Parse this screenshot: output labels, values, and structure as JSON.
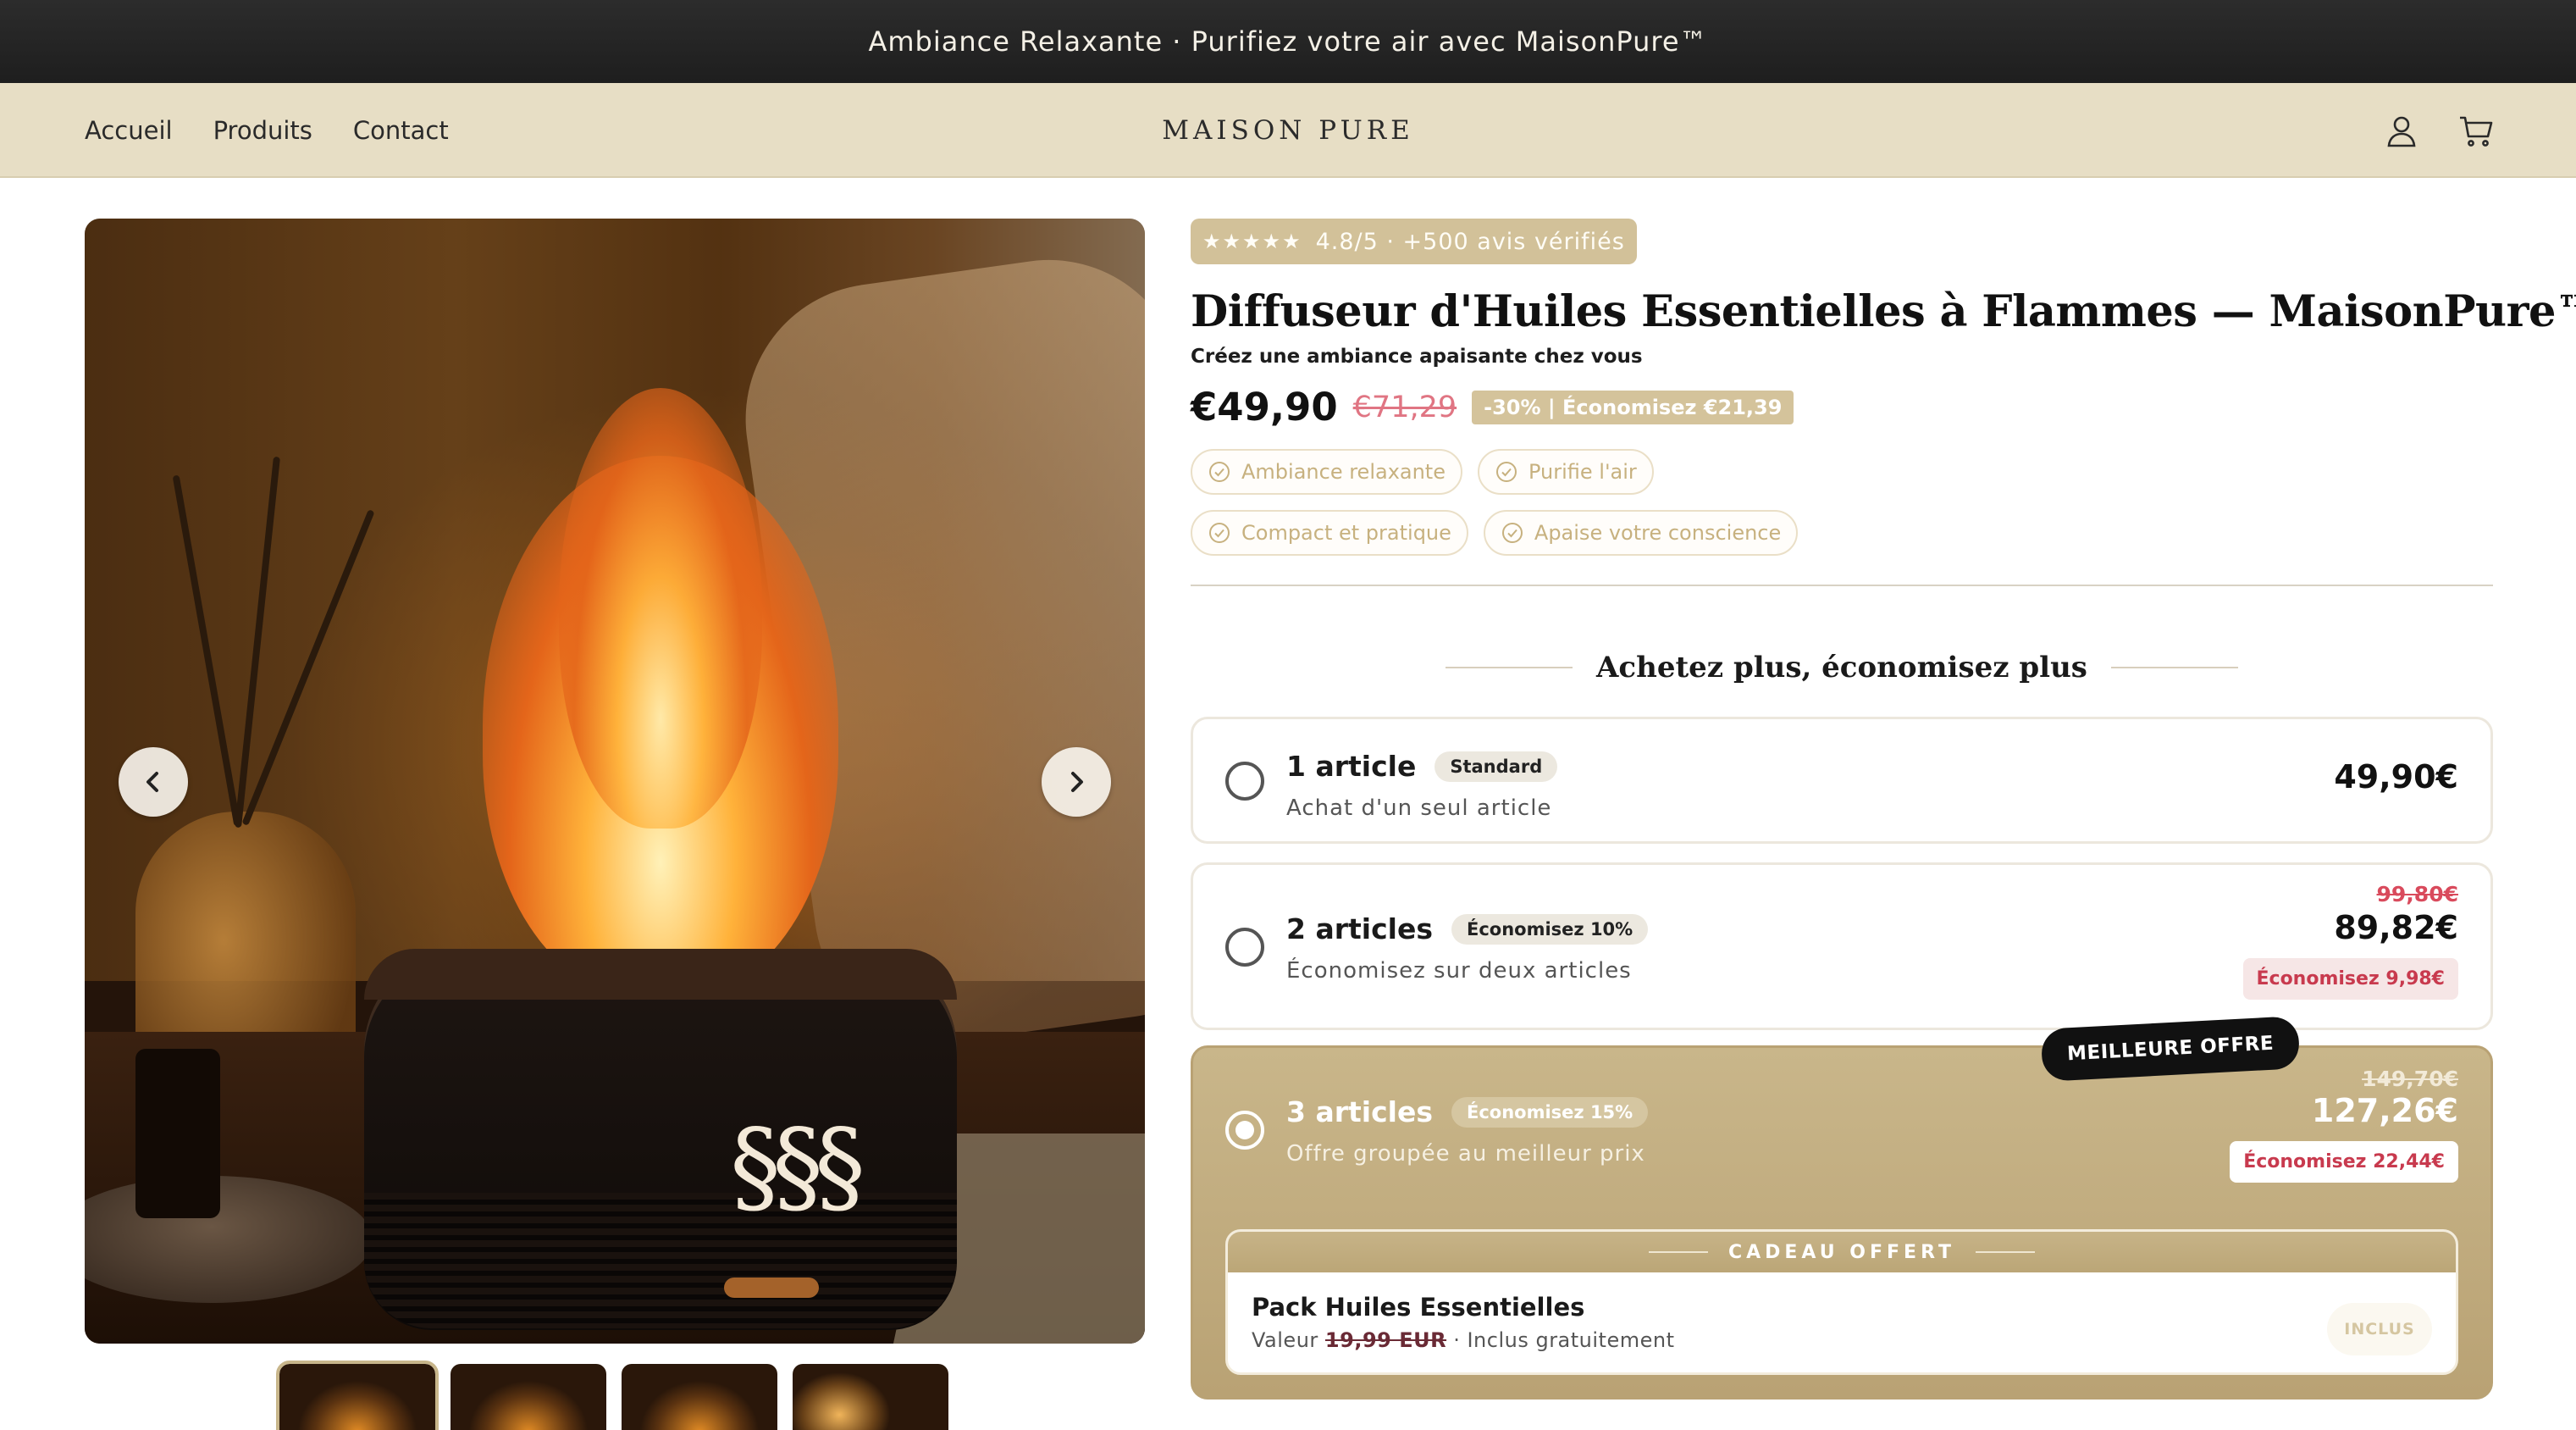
{
  "announcement": {
    "text": "Ambiance Relaxante · Purifiez votre air avec MaisonPure™"
  },
  "header": {
    "nav": [
      "Accueil",
      "Produits",
      "Contact"
    ],
    "logo": "MAISON PURE",
    "icons": [
      "user-icon",
      "cart-icon"
    ]
  },
  "gallery": {
    "prev_icon": "chevron-left-icon",
    "next_icon": "chevron-right-icon",
    "thumbnail_count": 4,
    "active_thumbnail": 1
  },
  "product": {
    "rating": {
      "stars": "★★★★★",
      "text": "4.8/5 · +500 avis vérifiés"
    },
    "title": "Diffuseur d'Huiles Essentielles à Flammes — MaisonPure™",
    "subtitle": "Créez une ambiance apaisante chez vous",
    "price": "€49,90",
    "old_price": "€71,29",
    "discount_badge": "-30% | Économisez €21,39",
    "benefits": [
      "Ambiance relaxante",
      "Purifie l'air",
      "Compact et pratique",
      "Apaise votre conscience"
    ]
  },
  "bundles": {
    "title": "Achetez plus, économisez plus",
    "options": [
      {
        "name": "1 article",
        "tag": "Standard",
        "desc": "Achat d'un seul article",
        "price": "49,90€",
        "selected": false
      },
      {
        "name": "2 articles",
        "tag": "Économisez 10%",
        "desc": "Économisez sur deux articles",
        "old_price": "99,80€",
        "price": "89,82€",
        "save": "Économisez 9,98€",
        "selected": false
      },
      {
        "name": "3 articles",
        "tag": "Économisez 15%",
        "desc": "Offre groupée au meilleur prix",
        "old_price": "149,70€",
        "price": "127,26€",
        "save": "Économisez 22,44€",
        "badge": "MEILLEURE OFFRE",
        "selected": true
      }
    ],
    "gift": {
      "header": "CADEAU OFFERT",
      "name": "Pack Huiles Essentielles",
      "value_label": "Valeur",
      "value": "19,99 EUR",
      "value_suffix": "· Inclus gratuitement",
      "included": "INCLUS"
    }
  },
  "colors": {
    "accent": "#c9b68a",
    "header_bg": "#e7dec5",
    "announce_bg": "#222222",
    "discount_red": "#c83a4e"
  }
}
